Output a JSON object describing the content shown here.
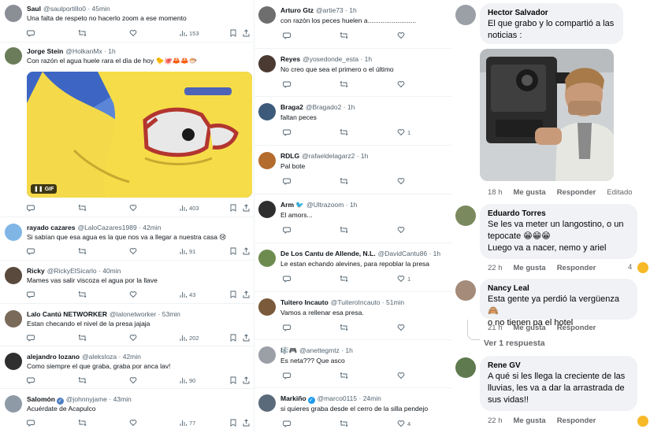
{
  "col1": {
    "tweets": [
      {
        "name": "Saul",
        "handle": "@saulportillo0",
        "time": "45min",
        "text": "Una falta de respeto no hacerlo zoom a ese momento",
        "views": "153"
      },
      {
        "name": "Jorge Stein",
        "handle": "@HolkanMx",
        "time": "1h",
        "text": "Con razón el agua huele rara el día de hoy 🐤🐙🦀🦀🐡",
        "views": "403",
        "gif_label": "GIF"
      },
      {
        "name": "rayado cazares",
        "handle": "@LaloCazares1989",
        "time": "42min",
        "text": "Si sabían que esa agua es la que nos va a llegar a nuestra casa 😢",
        "views": "91"
      },
      {
        "name": "Ricky",
        "handle": "@RickyElSicarlo",
        "time": "40min",
        "text": "Mames vas salir viscoza el agua por la llave",
        "views": "43"
      },
      {
        "name": "Lalo Cantú NETWORKER",
        "handle": "@lalonetworker",
        "time": "53min",
        "text": "Estan checando el nivel de la presa jajaja",
        "views": "202"
      },
      {
        "name": "alejandro lozano",
        "handle": "@aleksloza",
        "time": "42min",
        "text": "Como siempre el que graba, graba por anca lav!",
        "views": "90"
      },
      {
        "name": "Salomón",
        "handle": "@johnnyjame",
        "time": "43min",
        "text": "Acuérdate de Acapulco",
        "views": "77"
      }
    ]
  },
  "col2": {
    "tweets": [
      {
        "name": "Arturo Gtz",
        "handle": "@artie73",
        "time": "1h",
        "text": "con razón los peces huelen a..........................",
        "likes": ""
      },
      {
        "name": "Reyes",
        "handle": "@yosedonde_esta",
        "time": "1h",
        "text": "No creo que sea el primero o el último",
        "likes": ""
      },
      {
        "name": "Braga2",
        "handle": "@Bragado2",
        "time": "1h",
        "text": "faltan peces",
        "likes": "1"
      },
      {
        "name": "RDLG",
        "handle": "@rafaeldelagarz2",
        "time": "1h",
        "text": "Pal bote",
        "likes": ""
      },
      {
        "name": "Arm 🐦",
        "handle": "@Ultrazoom",
        "time": "1h",
        "text": "El amors...",
        "likes": ""
      },
      {
        "name": "De Los Cantu de Allende, N.L.",
        "handle": "@DavidCantu86",
        "time": "1h",
        "text": "Le estan echando alevines, para repoblar la presa",
        "likes": "1"
      },
      {
        "name": "Tuitero Incauto",
        "handle": "@TuiteroIncauto",
        "time": "51min",
        "text": "Vamos a rellenar esa presa.",
        "likes": ""
      },
      {
        "name": "🎼🎮",
        "handle": "@anettegmtz",
        "time": "1h",
        "text": "Es neta??? Que asco",
        "likes": ""
      },
      {
        "name": "Markiño",
        "handle": "@marco0115",
        "time": "24min",
        "text": "si quieres graba desde el cerro de la silla pendejo",
        "likes": "4"
      }
    ]
  },
  "col3": {
    "comments": [
      {
        "name": "Hector Salvador",
        "text": "El que grabo y lo compartió a las noticias :",
        "time": "18 h",
        "like": "Me gusta",
        "reply": "Responder",
        "edited": "Editado"
      },
      {
        "name": "Eduardo Torres",
        "text": "Se les va meter un langostino, o un tepocate 😁😁😁\nLuego va a nacer, nemo y ariel",
        "time": "22 h",
        "like": "Me gusta",
        "reply": "Responder",
        "reactions": "4"
      },
      {
        "name": "Nancy Leal",
        "text": "Esta gente ya perdió la vergüenza 🙈\no no tienen pa el hotel",
        "time": "21 h",
        "like": "Me gusta",
        "reply": "Responder",
        "more_replies": "Ver 1 respuesta"
      },
      {
        "name": "Rene GV",
        "text": "A qué si les llega la creciente de las lluvias, les va a dar la arrastrada de sus vidas!!",
        "time": "22 h",
        "like": "Me gusta",
        "reply": "Responder"
      }
    ]
  },
  "colors": {
    "accent": "#1d9bf0",
    "muted": "#536471",
    "bubble": "#f0f2f5",
    "fbmuted": "#65676b"
  }
}
